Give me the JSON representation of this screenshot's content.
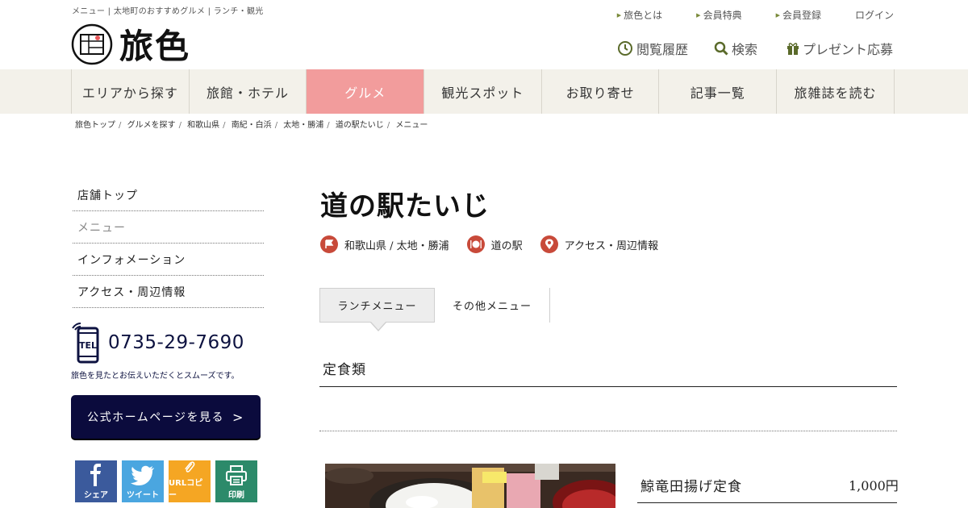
{
  "header": {
    "tagline": "メニュー | 太地町のおすすめグルメ | ランチ・観光",
    "logo_text": "旅色",
    "top_links": [
      "旅色とは",
      "会員特典",
      "会員登録",
      "ログイン"
    ],
    "utility": {
      "history": "閲覧履歴",
      "search": "検索",
      "present": "プレゼント応募"
    }
  },
  "nav": {
    "items": [
      "エリアから探す",
      "旅館・ホテル",
      "グルメ",
      "観光スポット",
      "お取り寄せ",
      "記事一覧",
      "旅雑誌を読む"
    ],
    "active_index": 2
  },
  "breadcrumb": [
    "旅色トップ",
    "グルメを探す",
    "和歌山県",
    "南紀・白浜",
    "太地・勝浦",
    "道の駅たいじ",
    "メニュー"
  ],
  "sidebar": {
    "menu": [
      "店舗トップ",
      "メニュー",
      "インフォメーション",
      "アクセス・周辺情報"
    ],
    "current_index": 1,
    "tel_label": "TEL",
    "tel_number": "0735-29-7690",
    "tel_note": "旅色を見たとお伝えいただくとスムーズです。",
    "homepage_button": "公式ホームページを見る",
    "share": {
      "facebook": "シェア",
      "twitter": "ツイート",
      "url_copy": "URLコピー",
      "print": "印刷"
    }
  },
  "main": {
    "title": "道の駅たいじ",
    "tags": {
      "area": "和歌山県 / 太地・勝浦",
      "genre": "道の駅",
      "access": "アクセス・周辺情報"
    },
    "tabs": [
      "ランチメニュー",
      "その他メニュー"
    ],
    "active_tab": 0,
    "section_title": "定食類",
    "menu_items": [
      {
        "name": "鯨竜田揚げ定食",
        "price": "1,000円"
      }
    ]
  },
  "colors": {
    "nav_bg": "#f3f1ea",
    "nav_active": "#f29c9c",
    "accent_olive": "#7a8a3a",
    "button_navy": "#0b0b3d",
    "tag_red": "#c84a3a"
  }
}
